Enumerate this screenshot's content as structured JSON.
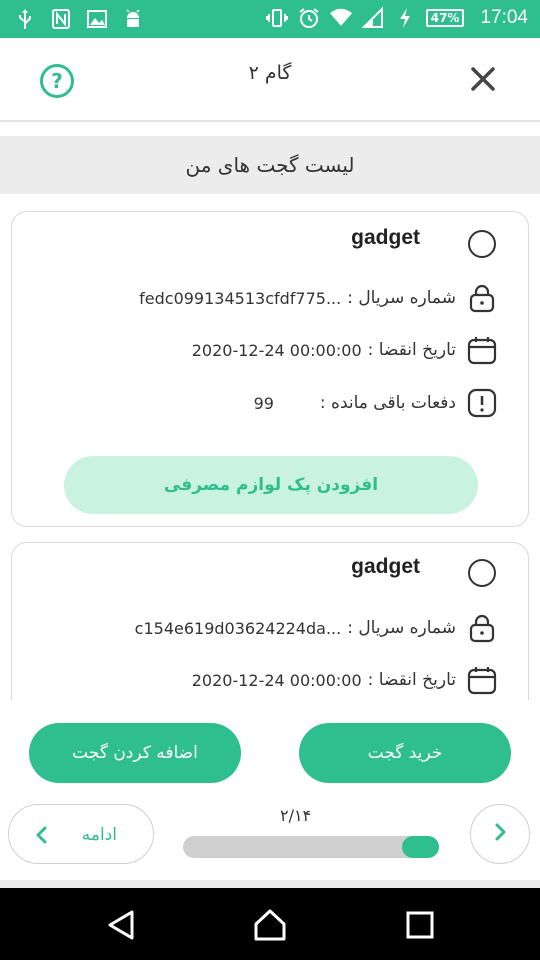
{
  "status_bar": {
    "battery": "47%",
    "time": "17:04",
    "icons": [
      "usb-icon",
      "nfc-icon",
      "image-icon",
      "android-icon",
      "vibrate-icon",
      "alarm-icon",
      "wifi-icon",
      "signal-icon",
      "charging-icon"
    ]
  },
  "app_bar": {
    "title": "گام ۲",
    "help_icon": "help-icon",
    "close_icon": "close-icon"
  },
  "section": {
    "title": "لیست گجت های من"
  },
  "gadgets": [
    {
      "name": "gadget",
      "serial_label": "شماره سریال :",
      "serial_value": "fedc099134513cfdf775...",
      "expiry_label": "تاریخ انقضا :",
      "expiry_value": "2020-12-24 00:00:00",
      "remaining_label": "دفعات باقی مانده :",
      "remaining_value": "99",
      "add_pack_label": "افزودن پک لوازم مصرفی"
    },
    {
      "name": "gadget",
      "serial_label": "شماره سریال :",
      "serial_value": "c154e619d03624224da...",
      "expiry_label": "تاریخ انقضا :",
      "expiry_value": "2020-12-24 00:00:00"
    }
  ],
  "actions": {
    "add_gadget": "اضافه کردن گجت",
    "buy_gadget": "خرید گجت"
  },
  "footer": {
    "next_label": "ادامه",
    "progress_text": "۲/۱۴",
    "progress_fraction": 0.142857
  },
  "colors": {
    "accent": "#2fbf8f",
    "accent_light": "#c9f2e1"
  }
}
